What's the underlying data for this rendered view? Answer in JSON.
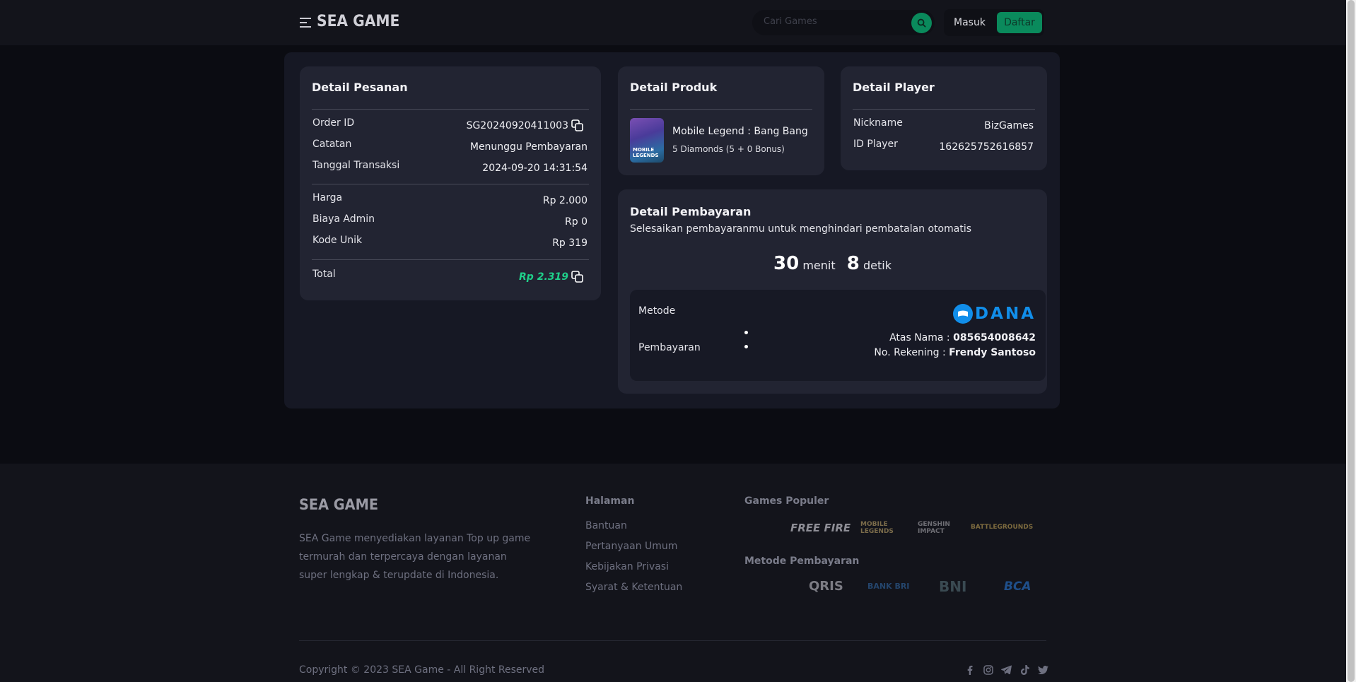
{
  "header": {
    "logo": "SEA GAME",
    "search_placeholder": "Cari Games",
    "login_label": "Masuk",
    "register_label": "Daftar"
  },
  "order": {
    "title": "Detail Pesanan",
    "order_id_label": "Order ID",
    "order_id": "SG20240920411003",
    "note_label": "Catatan",
    "note": "Menunggu Pembayaran",
    "date_label": "Tanggal Transaksi",
    "date": "2024-09-20 14:31:54",
    "price_label": "Harga",
    "price": "Rp 2.000",
    "admin_label": "Biaya Admin",
    "admin": "Rp 0",
    "unique_label": "Kode Unik",
    "unique": "Rp 319",
    "total_label": "Total",
    "total": "Rp 2.319"
  },
  "product": {
    "title": "Detail Produk",
    "name": "Mobile Legend : Bang Bang",
    "item": "5 Diamonds (5 + 0 Bonus)",
    "image_text": "MOBILE LEGENDS"
  },
  "player": {
    "title": "Detail Player",
    "nickname_label": "Nickname",
    "nickname": "BizGames",
    "id_label": "ID Player",
    "id": "162625752616857"
  },
  "payment": {
    "title": "Detail Pembayaran",
    "subtitle": "Selesaikan pembayaranmu untuk menghindari pembatalan otomatis",
    "minutes": "30",
    "minutes_unit": "menit",
    "seconds": "8",
    "seconds_unit": "detik",
    "method_label": "Metode",
    "method_logo": "DANA",
    "payment_label": "Pembayaran",
    "name_label": "Atas Nama : ",
    "name_value": "085654008642",
    "account_label": "No. Rekening : ",
    "account_value": "Frendy Santoso"
  },
  "footer": {
    "logo": "SEA GAME",
    "description": "SEA Game menyediakan layanan Top up game termurah dan terpercaya dengan layanan super lengkap & terupdate di Indonesia.",
    "pages_title": "Halaman",
    "links": [
      "Bantuan",
      "Pertanyaan Umum",
      "Kebijakan Privasi",
      "Syarat & Ketentuan"
    ],
    "games_title": "Games Populer",
    "games": [
      "FREE FIRE",
      "MOBILE LEGENDS",
      "GENSHIN IMPACT",
      "BATTLEGROUNDS"
    ],
    "payments_title": "Metode Pembayaran",
    "payment_logos": [
      "QRIS",
      "BANK BRI",
      "BNI",
      "BCA"
    ],
    "copyright": "Copyright © 2023 SEA Game - All Right Reserved"
  },
  "colors": {
    "accent": "#0a8a5c",
    "total_green": "#1fd08a",
    "dana_blue": "#118eea"
  }
}
